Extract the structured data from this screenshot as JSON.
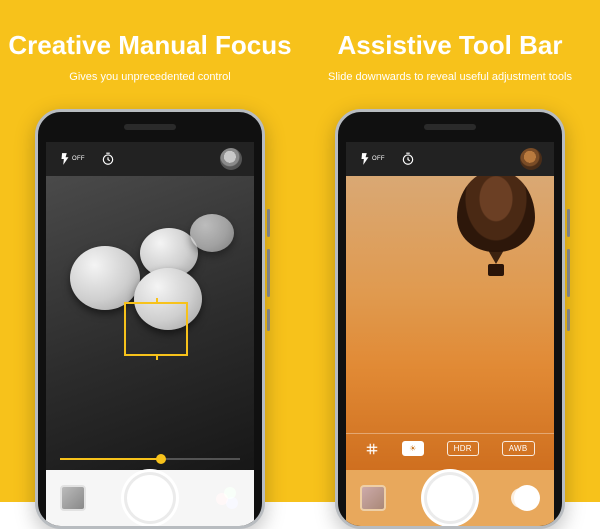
{
  "left": {
    "title": "Creative Manual Focus",
    "subtitle": "Gives you unprecedented control",
    "flash_label": "OFF",
    "focus_slider_pct": 56
  },
  "right": {
    "title": "Assistive Tool Bar",
    "subtitle": "Slide downwards to reveal useful adjustment tools",
    "flash_label": "OFF",
    "tools": {
      "grid": "grid",
      "wb_active": "☀",
      "hdr": "HDR",
      "awb": "AWB"
    }
  }
}
